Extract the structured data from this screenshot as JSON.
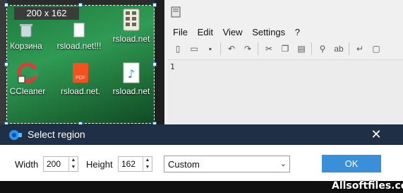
{
  "region_overlay": {
    "size_label": "200 x 162"
  },
  "desktop_icons": [
    {
      "label": "Корзина",
      "icon": "recycle-bin-icon"
    },
    {
      "label": "rsload.net!!!",
      "icon": "blank-file-icon"
    },
    {
      "label": "rsload.net",
      "icon": "calculator-icon"
    },
    {
      "label": "CCleaner",
      "icon": "ccleaner-icon"
    },
    {
      "label": "rsload.net.",
      "icon": "pdf-file-icon"
    },
    {
      "label": "rsload.net",
      "icon": "music-file-icon"
    }
  ],
  "editor": {
    "menu": [
      "File",
      "Edit",
      "View",
      "Settings",
      "?"
    ],
    "line_number": "1"
  },
  "dialog": {
    "title": "Select region",
    "width_label": "Width",
    "width_value": "200",
    "height_label": "Height",
    "height_value": "162",
    "preset": "Custom",
    "ok_label": "OK",
    "close_glyph": "✕"
  },
  "watermark": "Allsoftfiles.com",
  "colors": {
    "dialog_header": "#1f2f46",
    "ok_button": "#3a90d8",
    "region_green": "#2f9b55"
  }
}
